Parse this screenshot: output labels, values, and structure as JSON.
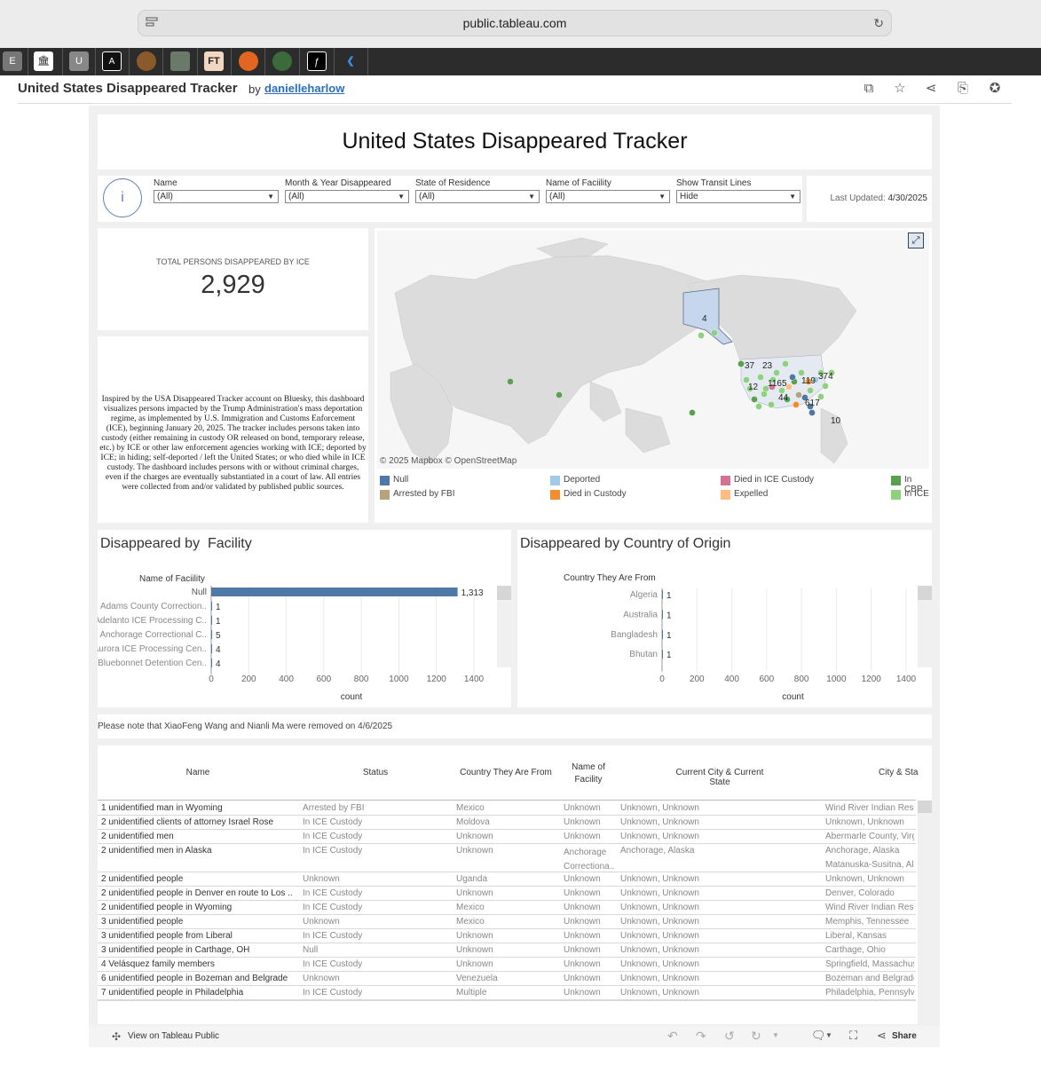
{
  "browser": {
    "url": "public.tableau.com"
  },
  "bookmarks": [
    "E",
    "U",
    "A",
    "FT"
  ],
  "header": {
    "title": "United States Disappeared Tracker",
    "by": "by",
    "author": "danielleharlow"
  },
  "dashboard": {
    "title": "United States Disappeared Tracker",
    "info_icon": "i",
    "filters": [
      {
        "label": "Name",
        "value": "(All)"
      },
      {
        "label": "Month & Year Disappeared",
        "value": "(All)"
      },
      {
        "label": "State of Residence",
        "value": "(All)"
      },
      {
        "label": "Name of Faciility",
        "value": "(All)"
      },
      {
        "label": "Show Transit Lines",
        "value": "Hide"
      }
    ],
    "last_updated_label": "Last Updated:",
    "last_updated": "4/30/2025",
    "kpi_label": "TOTAL PERSONS DISAPPEARED BY ICE",
    "kpi_value": "2,929",
    "description": "Inspired by the USA Disappeared Tracker account on Bluesky, this dashboard visualizes persons impacted by the Trump Administration's mass deportation regime, as implemented by U.S. Immigration and Customs Enforcement (ICE), beginning January 20, 2025. The tracker includes persons taken into custody (either remaining in custody OR released on bond, temporary release, etc.) by ICE or other law enforcement agencies working with ICE; deported by ICE; in hiding; self-deported / left the United States; or who died while in ICE custody. The dashboard includes persons with or without criminal charges, even if the charges are eventually substantiated in a court of law. All entries were collected from and/or validated by published public sources.",
    "map_attribution": "© 2025 Mapbox  © OpenStreetMap",
    "map_labels": [
      "4",
      "37",
      "23",
      "12",
      "1165",
      "119",
      "374",
      "44",
      "617",
      "10"
    ],
    "legend": [
      {
        "label": "Null",
        "color": "#4e79a7"
      },
      {
        "label": "Deported",
        "color": "#a0cbe8"
      },
      {
        "label": "Died in ICE Custody",
        "color": "#d37295"
      },
      {
        "label": "In CBP",
        "color": "#59a14f"
      },
      {
        "label": "Arrested by FBI",
        "color": "#b6a27d"
      },
      {
        "label": "Died in Custody",
        "color": "#f28e2b"
      },
      {
        "label": "Expelled",
        "color": "#ffbe7d"
      },
      {
        "label": "In ICE",
        "color": "#8cd17d"
      }
    ],
    "note": "Please note that XiaoFeng Wang and Nianli Ma were removed on 4/6/2025"
  },
  "chart_data": [
    {
      "type": "bar",
      "title": "Disappeared by  Facility",
      "category_header": "Name of Faciility",
      "categories": [
        "Null",
        "Adams County Correction..",
        "Adelanto ICE Processing C..",
        "Anchorage Correctional C..",
        "Aurora ICE Processing Cen..",
        "Bluebonnet Detention Cen.."
      ],
      "values": [
        1313,
        1,
        1,
        5,
        4,
        4
      ],
      "value_labels": [
        "1,313",
        "1",
        "1",
        "5",
        "4",
        "4"
      ],
      "xlabel": "count",
      "xticks": [
        0,
        200,
        400,
        600,
        800,
        1000,
        1200,
        1400
      ],
      "xlim": [
        0,
        1400
      ],
      "color": "#4e79a7"
    },
    {
      "type": "bar",
      "title": "Disappeared by Country of Origin",
      "category_header": "Country They Are From",
      "categories": [
        "Algeria",
        "Australia",
        "Bangladesh",
        "Bhutan"
      ],
      "values": [
        1,
        1,
        1,
        1
      ],
      "value_labels": [
        "1",
        "1",
        "1",
        "1"
      ],
      "xlabel": "count",
      "xticks": [
        0,
        200,
        400,
        600,
        800,
        1000,
        1200,
        1400
      ],
      "xlim": [
        0,
        1400
      ],
      "color": "#4e79a7"
    }
  ],
  "table": {
    "headers": [
      "Name",
      "Status",
      "Country They Are From",
      "Name of Facility",
      "Current City & Current State",
      "City & Sta"
    ],
    "rows": [
      [
        "1 unidentified man in Wyoming",
        "Arrested by FBI",
        "Mexico",
        "Unknown",
        "Unknown, Unknown",
        "Wind River Indian Rese"
      ],
      [
        "2 unidentified clients of attorney Israel Rose",
        "In ICE Custody",
        "Moldova",
        "Unknown",
        "Unknown, Unknown",
        "Unknown, Unknown"
      ],
      [
        "2 unidentified men",
        "In ICE Custody",
        "Unknown",
        "Unknown",
        "Unknown, Unknown",
        "Abermarle County, Virg"
      ],
      [
        "2 unidentified men in Alaska",
        "In ICE Custody",
        "Unknown",
        "Anchorage Correctiona..",
        "Anchorage, Alaska",
        "Anchorage, Alaska|Matanuska-Susitna, Ala"
      ],
      [
        "2 unidentified people",
        "Unknown",
        "Uganda",
        "Unknown",
        "Unknown, Unknown",
        "Unknown, Unknown"
      ],
      [
        "2 unidentified people in Denver en route to Los ..",
        "In ICE Custody",
        "Unknown",
        "Unknown",
        "Unknown, Unknown",
        "Denver, Colorado"
      ],
      [
        "2 unidentified people in Wyoming",
        "In ICE Custody",
        "Mexico",
        "Unknown",
        "Unknown, Unknown",
        "Wind River Indian Rese"
      ],
      [
        "3 unidentified people",
        "Unknown",
        "Mexico",
        "Unknown",
        "Unknown, Unknown",
        "Memphis, Tennessee"
      ],
      [
        "3 unidentified people from Liberal",
        "In ICE Custody",
        "Unknown",
        "Unknown",
        "Unknown, Unknown",
        "Liberal, Kansas"
      ],
      [
        "3 unidentified people in Carthage, OH",
        "Null",
        "Unknown",
        "Unknown",
        "Unknown, Unknown",
        "Carthage, Ohio"
      ],
      [
        "4 Velásquez family members",
        "In ICE Custody",
        "Unknown",
        "Unknown",
        "Unknown, Unknown",
        "Springfield, Massachus"
      ],
      [
        "6 unidentified people in Bozeman and Belgrade",
        "Unknown",
        "Venezuela",
        "Unknown",
        "Unknown, Unknown",
        "Bozeman and Belgrade"
      ],
      [
        "7 unidentified people in Philadelphia",
        "In ICE Custody",
        "Multiple",
        "Unknown",
        "Unknown, Unknown",
        "Philadelphia, Pennsylva"
      ]
    ]
  },
  "footer": {
    "view_on": "View on Tableau Public",
    "share": "Share"
  }
}
